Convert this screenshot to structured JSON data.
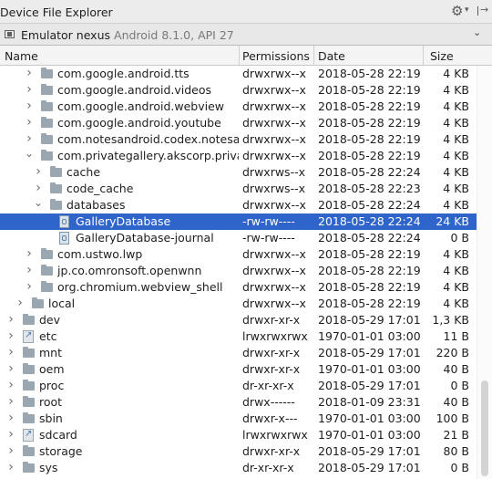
{
  "window": {
    "title": "Device File Explorer"
  },
  "device": {
    "name": "Emulator nexus",
    "version": "Android 8.1.0, API 27"
  },
  "columns": {
    "name": "Name",
    "permissions": "Permissions",
    "date": "Date",
    "size": "Size"
  },
  "rows": [
    {
      "name": "com.google.android.tts",
      "permissions": "drwxrwx--x",
      "date": "2018-05-28 22:19",
      "size": "4 KB",
      "depth": 2,
      "expanded": false,
      "kind": "folder"
    },
    {
      "name": "com.google.android.videos",
      "permissions": "drwxrwx--x",
      "date": "2018-05-28 22:19",
      "size": "4 KB",
      "depth": 2,
      "expanded": false,
      "kind": "folder"
    },
    {
      "name": "com.google.android.webview",
      "permissions": "drwxrwx--x",
      "date": "2018-05-28 22:19",
      "size": "4 KB",
      "depth": 2,
      "expanded": false,
      "kind": "folder"
    },
    {
      "name": "com.google.android.youtube",
      "permissions": "drwxrwx--x",
      "date": "2018-05-28 22:19",
      "size": "4 KB",
      "depth": 2,
      "expanded": false,
      "kind": "folder"
    },
    {
      "name": "com.notesandroid.codex.notesandroid",
      "permissions": "drwxrwx--x",
      "date": "2018-05-28 22:19",
      "size": "4 KB",
      "depth": 2,
      "expanded": false,
      "kind": "folder"
    },
    {
      "name": "com.privategallery.akscorp.privategalleryandroid",
      "permissions": "drwxrwx--x",
      "date": "2018-05-28 22:19",
      "size": "4 KB",
      "depth": 2,
      "expanded": true,
      "kind": "folder"
    },
    {
      "name": "cache",
      "permissions": "drwxrws--x",
      "date": "2018-05-28 22:24",
      "size": "4 KB",
      "depth": 3,
      "expanded": false,
      "kind": "folder"
    },
    {
      "name": "code_cache",
      "permissions": "drwxrws--x",
      "date": "2018-05-28 22:23",
      "size": "4 KB",
      "depth": 3,
      "expanded": false,
      "kind": "folder"
    },
    {
      "name": "databases",
      "permissions": "drwxrwx--x",
      "date": "2018-05-28 22:24",
      "size": "4 KB",
      "depth": 3,
      "expanded": true,
      "kind": "folder"
    },
    {
      "name": "GalleryDatabase",
      "permissions": "-rw-rw----",
      "date": "2018-05-28 22:24",
      "size": "24 KB",
      "depth": 4,
      "kind": "db",
      "selected": true
    },
    {
      "name": "GalleryDatabase-journal",
      "permissions": "-rw-rw----",
      "date": "2018-05-28 22:24",
      "size": "0 B",
      "depth": 4,
      "kind": "db"
    },
    {
      "name": "com.ustwo.lwp",
      "permissions": "drwxrwx--x",
      "date": "2018-05-28 22:19",
      "size": "4 KB",
      "depth": 2,
      "expanded": false,
      "kind": "folder"
    },
    {
      "name": "jp.co.omronsoft.openwnn",
      "permissions": "drwxrwx--x",
      "date": "2018-05-28 22:19",
      "size": "4 KB",
      "depth": 2,
      "expanded": false,
      "kind": "folder"
    },
    {
      "name": "org.chromium.webview_shell",
      "permissions": "drwxrwx--x",
      "date": "2018-05-28 22:19",
      "size": "4 KB",
      "depth": 2,
      "expanded": false,
      "kind": "folder"
    },
    {
      "name": "local",
      "permissions": "drwxrwx--x",
      "date": "2018-05-28 22:19",
      "size": "4 KB",
      "depth": 1,
      "expanded": false,
      "kind": "folder"
    },
    {
      "name": "dev",
      "permissions": "drwxr-xr-x",
      "date": "2018-05-29 17:01",
      "size": "1,3 KB",
      "depth": 0,
      "expanded": false,
      "kind": "folder"
    },
    {
      "name": "etc",
      "permissions": "lrwxrwxrwx",
      "date": "1970-01-01 03:00",
      "size": "11 B",
      "depth": 0,
      "expanded": false,
      "kind": "link"
    },
    {
      "name": "mnt",
      "permissions": "drwxr-xr-x",
      "date": "2018-05-29 17:01",
      "size": "220 B",
      "depth": 0,
      "expanded": false,
      "kind": "folder"
    },
    {
      "name": "oem",
      "permissions": "drwxr-xr-x",
      "date": "1970-01-01 03:00",
      "size": "40 B",
      "depth": 0,
      "expanded": false,
      "kind": "folder"
    },
    {
      "name": "proc",
      "permissions": "dr-xr-xr-x",
      "date": "2018-05-29 17:01",
      "size": "0 B",
      "depth": 0,
      "expanded": false,
      "kind": "folder"
    },
    {
      "name": "root",
      "permissions": "drwx------",
      "date": "2018-01-09 23:31",
      "size": "40 B",
      "depth": 0,
      "expanded": false,
      "kind": "folder"
    },
    {
      "name": "sbin",
      "permissions": "drwxr-x---",
      "date": "1970-01-01 03:00",
      "size": "100 B",
      "depth": 0,
      "expanded": false,
      "kind": "folder"
    },
    {
      "name": "sdcard",
      "permissions": "lrwxrwxrwx",
      "date": "1970-01-01 03:00",
      "size": "21 B",
      "depth": 0,
      "expanded": false,
      "kind": "link"
    },
    {
      "name": "storage",
      "permissions": "drwxr-xr-x",
      "date": "2018-05-29 17:01",
      "size": "80 B",
      "depth": 0,
      "expanded": false,
      "kind": "folder"
    },
    {
      "name": "sys",
      "permissions": "dr-xr-xr-x",
      "date": "2018-05-29 17:01",
      "size": "0 B",
      "depth": 0,
      "expanded": false,
      "kind": "folder"
    }
  ],
  "colors": {
    "selection": "#2f65ca",
    "folder": "#9aa7b0"
  },
  "icons": {
    "settings": "gear-icon",
    "hide": "hide-panel-icon",
    "device": "device-icon",
    "dropdown": "chevron-down-icon"
  }
}
